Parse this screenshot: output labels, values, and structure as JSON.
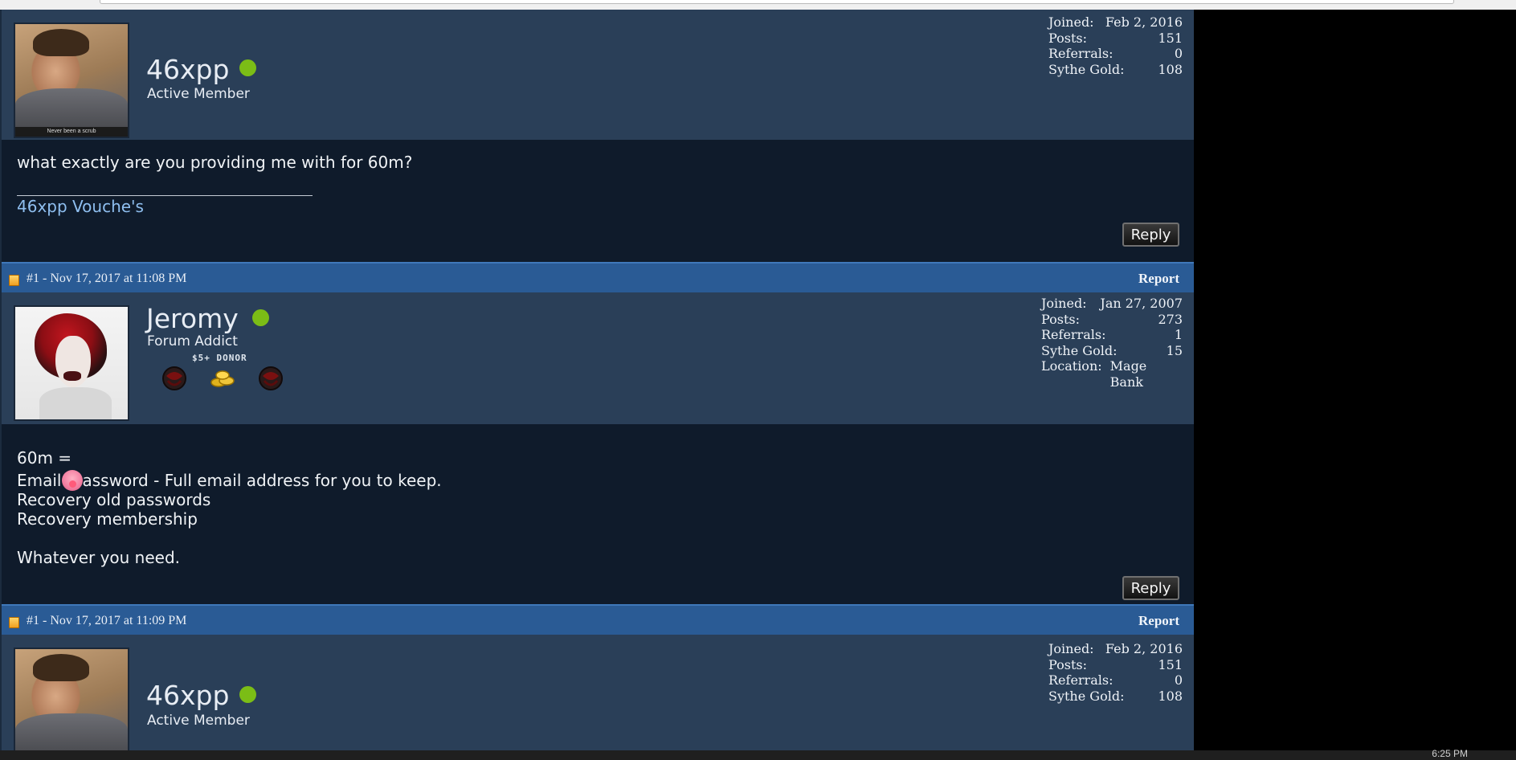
{
  "posts": [
    {
      "username": "46xpp",
      "title": "Active Member",
      "avatar_caption": "Never been a scrub",
      "stats": [
        {
          "label": "Joined:",
          "value": "Feb 2, 2016"
        },
        {
          "label": "Posts:",
          "value": "151"
        },
        {
          "label": "Referrals:",
          "value": "0"
        },
        {
          "label": "Sythe Gold:",
          "value": "108"
        }
      ],
      "body": [
        "what exactly are you providing me with for 60m?"
      ],
      "signature_link": "46xpp Vouche's",
      "reply_label": "Reply"
    },
    {
      "header": "#1 - Nov 17, 2017 at 11:08 PM",
      "report_label": "Report",
      "username": "Jeromy",
      "title": "Forum Addict",
      "donor_label": "$5+ DONOR",
      "stats": [
        {
          "label": "Joined:",
          "value": "Jan 27, 2007"
        },
        {
          "label": "Posts:",
          "value": "273"
        },
        {
          "label": "Referrals:",
          "value": "1"
        },
        {
          "label": "Sythe Gold:",
          "value": "15"
        },
        {
          "label": "Location:",
          "value": "Mage Bank"
        }
      ],
      "body": [
        "60m =",
        "Email",
        "assword - Full email address for you to keep.",
        "Recovery old passwords",
        "Recovery membership",
        "Whatever you need."
      ],
      "reply_label": "Reply"
    },
    {
      "header": "#1 - Nov 17, 2017 at 11:09 PM",
      "report_label": "Report",
      "username": "46xpp",
      "title": "Active Member",
      "stats": [
        {
          "label": "Joined:",
          "value": "Feb 2, 2016"
        },
        {
          "label": "Posts:",
          "value": "151"
        },
        {
          "label": "Referrals:",
          "value": "0"
        },
        {
          "label": "Sythe Gold:",
          "value": "108"
        }
      ]
    }
  ],
  "colors": {
    "header_blue": "#2a5b95",
    "userbar": "#2a3f58",
    "body_bg": "#0f1b2b",
    "online": "#7bbd16",
    "link": "#8fbff0"
  },
  "clock": "6:25 PM"
}
